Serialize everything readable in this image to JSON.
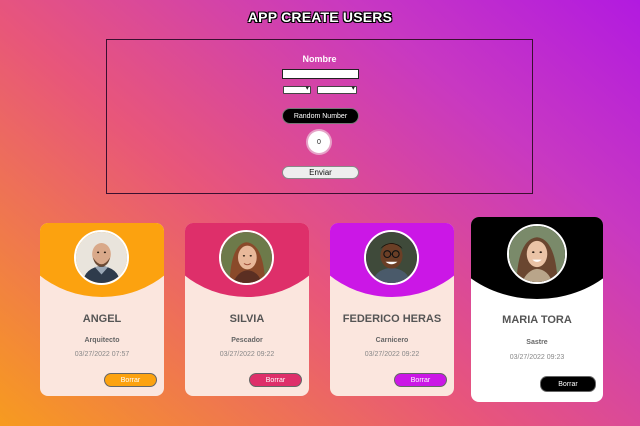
{
  "app": {
    "title": "APP CREATE USERS"
  },
  "form": {
    "name_label": "Nombre",
    "name_value": "",
    "select_a_value": "",
    "select_b_value": "",
    "random_button": "Random Number",
    "counter": "0",
    "submit_button": "Enviar"
  },
  "colors": {
    "angel": "#fca20f",
    "silvia": "#de2f6a",
    "federico": "#cb17e6",
    "maria": "#000000"
  },
  "cards": [
    {
      "name": "ANGEL",
      "job": "Arquitecto",
      "date": "03/27/2022 07:57",
      "delete_label": "Borrar",
      "icon": "bald-man-avatar"
    },
    {
      "name": "SILVIA",
      "job": "Pescador",
      "date": "03/27/2022 09:22",
      "delete_label": "Borrar",
      "icon": "woman-avatar"
    },
    {
      "name": "FEDERICO HERAS",
      "job": "Carnicero",
      "date": "03/27/2022 09:22",
      "delete_label": "Borrar",
      "icon": "man-glasses-avatar"
    },
    {
      "name": "MARIA TORA",
      "job": "Sastre",
      "date": "03/27/2022 09:23",
      "delete_label": "Borrar",
      "icon": "woman-avatar"
    }
  ]
}
